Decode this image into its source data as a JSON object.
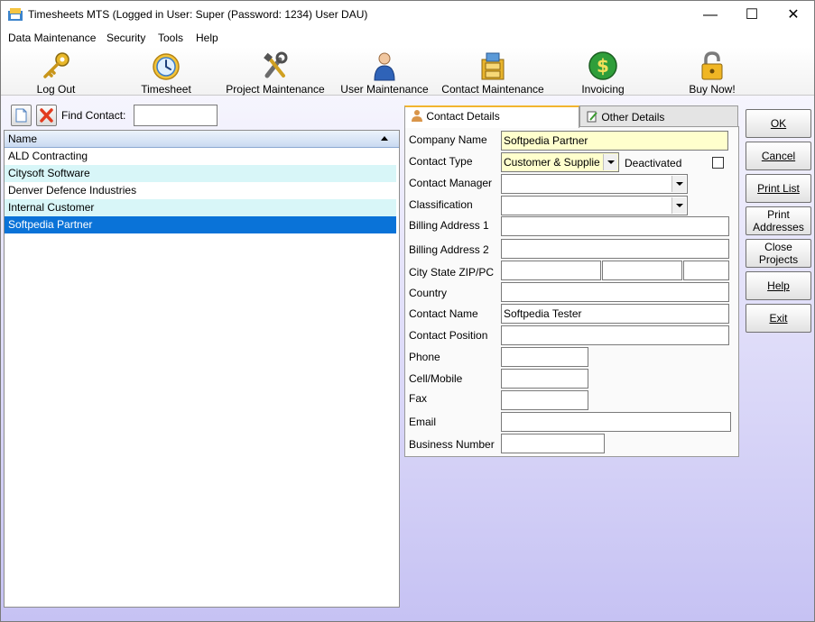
{
  "window": {
    "title": "Timesheets MTS (Logged in User: Super (Password: 1234) User DAU)",
    "controls": {
      "minimize": "—",
      "maximize": "☐",
      "close": "✕"
    }
  },
  "menu": [
    "Data Maintenance",
    "Security",
    "Tools",
    "Help"
  ],
  "toolbar": [
    {
      "label": "Log Out",
      "icon": "key-icon"
    },
    {
      "label": "Timesheet",
      "icon": "clock-icon"
    },
    {
      "label": "Project Maintenance",
      "icon": "tools-icon"
    },
    {
      "label": "User Maintenance",
      "icon": "user-icon"
    },
    {
      "label": "Contact Maintenance",
      "icon": "filing-cabinet-icon"
    },
    {
      "label": "Invoicing",
      "icon": "dollar-icon"
    },
    {
      "label": "Buy Now!",
      "icon": "padlock-icon"
    }
  ],
  "find": {
    "label": "Find Contact:",
    "value": ""
  },
  "list": {
    "header": "Name",
    "rows": [
      "ALD Contracting",
      "Citysoft Software",
      "Denver Defence Industries",
      "Internal Customer",
      "Softpedia Partner"
    ],
    "selected_index": 4
  },
  "tabs": [
    "Contact Details",
    "Other Details"
  ],
  "form": {
    "company_name": {
      "label": "Company Name",
      "value": "Softpedia Partner"
    },
    "contact_type": {
      "label": "Contact Type",
      "value": "Customer & Supplie"
    },
    "deactivated": {
      "label": "Deactivated",
      "checked": false
    },
    "contact_manager": {
      "label": "Contact Manager",
      "value": ""
    },
    "classification": {
      "label": "Classification",
      "value": ""
    },
    "billing_address_1": {
      "label": "Billing Address 1",
      "value": ""
    },
    "billing_address_2": {
      "label": "Billing Address 2",
      "value": ""
    },
    "city_state_zip": {
      "label": "City State ZIP/PC",
      "city": "",
      "state": "",
      "zip": ""
    },
    "country": {
      "label": "Country",
      "value": ""
    },
    "contact_name": {
      "label": "Contact Name",
      "value": "Softpedia Tester"
    },
    "contact_position": {
      "label": "Contact Position",
      "value": ""
    },
    "phone": {
      "label": "Phone",
      "value": ""
    },
    "cell": {
      "label": "Cell/Mobile",
      "value": ""
    },
    "fax": {
      "label": "Fax",
      "value": ""
    },
    "email": {
      "label": "Email",
      "value": ""
    },
    "business_number": {
      "label": "Business Number",
      "value": ""
    }
  },
  "buttons": {
    "ok": "OK",
    "cancel": "Cancel",
    "print_list": "Print List",
    "print_addresses_1": "Print",
    "print_addresses_2": "Addresses",
    "close_projects_1": "Close",
    "close_projects_2": "Projects",
    "help": "Help",
    "exit": "Exit"
  }
}
